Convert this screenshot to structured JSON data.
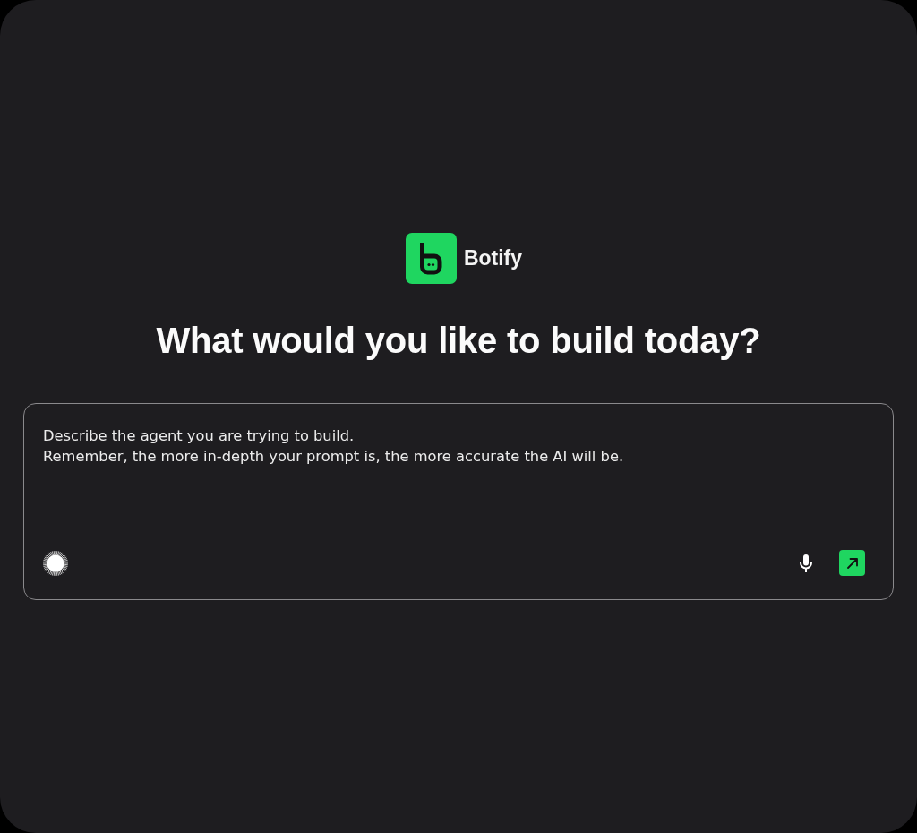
{
  "brand": {
    "name": "Botify"
  },
  "heading": "What would you like to build today?",
  "prompt": {
    "placeholder": "Describe the agent you are trying to build.\nRemember, the more in-depth your prompt is, the more accurate the AI will be."
  }
}
